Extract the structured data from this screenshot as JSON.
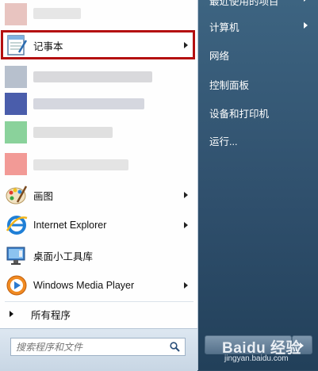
{
  "left_menu": {
    "pinned": [
      {
        "label": "记事本",
        "icon": "notepad-icon",
        "has_submenu": true,
        "highlighted": true
      }
    ],
    "programs": [
      {
        "label": "画图",
        "icon": "paint-icon",
        "has_submenu": true
      },
      {
        "label": "Internet Explorer",
        "icon": "internet-explorer-icon",
        "has_submenu": true
      },
      {
        "label": "桌面小工具库",
        "icon": "desktop-gadgets-icon",
        "has_submenu": false
      },
      {
        "label": "Windows Media Player",
        "icon": "windows-media-player-icon",
        "has_submenu": true
      }
    ],
    "all_programs_label": "所有程序",
    "search_placeholder": "搜索程序和文件"
  },
  "right_menu": {
    "items": [
      {
        "label": "最近使用的项目",
        "has_submenu": true
      },
      {
        "label": "计算机",
        "has_submenu": true
      },
      {
        "label": "网络",
        "has_submenu": false
      },
      {
        "label": "控制面板",
        "has_submenu": false
      },
      {
        "label": "设备和打印机",
        "has_submenu": false
      },
      {
        "label": "运行...",
        "has_submenu": false
      }
    ]
  },
  "watermark": {
    "main": "Baidu 经验",
    "sub": "jingyan.baidu.com"
  },
  "colors": {
    "highlight_border": "#b40f10",
    "right_panel": "#2f4f6c"
  }
}
